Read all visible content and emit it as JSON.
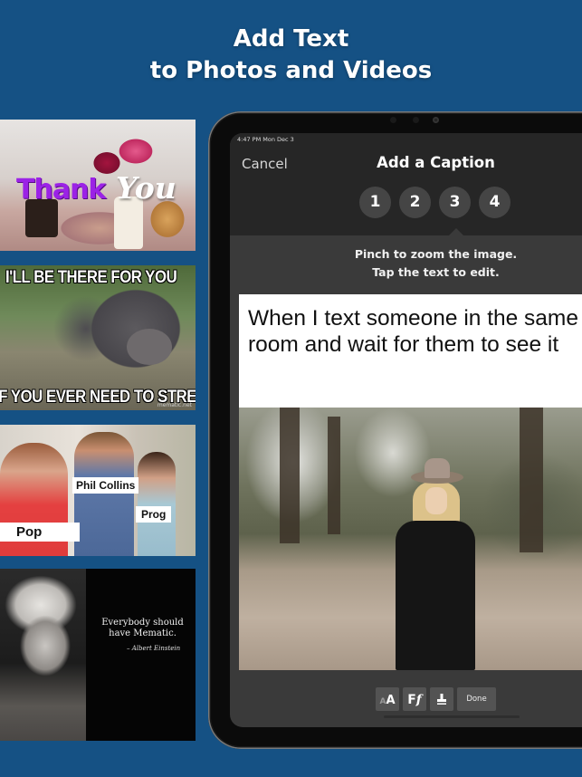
{
  "headline": {
    "line1": "Add Text",
    "line2": "to Photos and Videos"
  },
  "thumbnails": [
    {
      "name": "thank-you-meme",
      "text_parts": [
        "Thank",
        "You"
      ]
    },
    {
      "name": "pig-meme",
      "top_text": "I'LL BE THERE FOR YOU",
      "bottom_text": "IF YOU EVER NEED TO STRESS EAT",
      "watermark": "mematic.net"
    },
    {
      "name": "distracted-boyfriend-meme",
      "labels": [
        "Phil Collins",
        "Prog",
        "Pop"
      ]
    },
    {
      "name": "einstein-quote-meme",
      "quote": "Everybody should have Mematic.",
      "author": "– Albert Einstein"
    }
  ],
  "device": {
    "status_bar": "4:47 PM   Mon Dec 3",
    "nav": {
      "cancel_label": "Cancel",
      "title": "Add a Caption"
    },
    "steps": [
      {
        "label": "1",
        "active": false
      },
      {
        "label": "2",
        "active": false
      },
      {
        "label": "3",
        "active": true
      },
      {
        "label": "4",
        "active": false
      }
    ],
    "hint_line1": "Pinch to zoom the image.",
    "hint_line2": "Tap the text to edit.",
    "caption": {
      "line1": "When I text someone in the same",
      "line2": "room and wait for them to see it"
    },
    "toolbar": {
      "text_size_icon": "AA",
      "font_icon": "Ff",
      "stamp_icon": "stamp",
      "done_label": "Done"
    }
  }
}
